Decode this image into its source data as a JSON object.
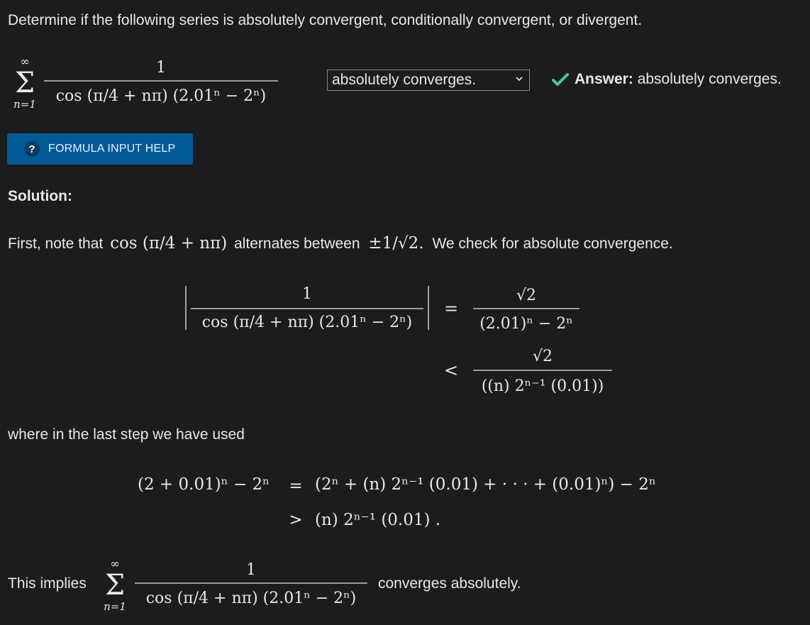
{
  "question": {
    "prompt": "Determine if the following series is absolutely convergent, conditionally convergent, or divergent."
  },
  "series": {
    "sum_upper": "∞",
    "sum_lower": "n=1",
    "numerator": "1",
    "denominator": "cos (π/4 + nπ) (2.01ⁿ − 2ⁿ)"
  },
  "answer_select": {
    "selected": "absolutely converges."
  },
  "feedback": {
    "label": "Answer:",
    "value": "absolutely converges."
  },
  "help_button": {
    "icon_text": "?",
    "label": "FORMULA INPUT HELP"
  },
  "solution": {
    "heading": "Solution:",
    "para1_before": "First, note that",
    "para1_math1": "cos (π/4 + nπ)",
    "para1_mid": "alternates between",
    "para1_math2": "±1/√2.",
    "para1_after": "We check for absolute convergence.",
    "para2": "where in the last step we have used",
    "para3_before": "This implies",
    "para3_after": "converges absolutely."
  },
  "colors": {
    "background": "#1c1c1e",
    "text": "#e8e8e8",
    "check": "#3ecf8e",
    "button": "#005a96"
  }
}
